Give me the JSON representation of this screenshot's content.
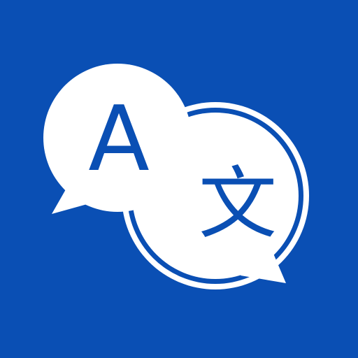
{
  "colors": {
    "background": "#0a4fb4",
    "bubble": "#ffffff",
    "glyph": "#0a4fb4"
  },
  "icon": {
    "name": "translate-icon",
    "source_glyph": "A",
    "target_glyph": "文"
  }
}
